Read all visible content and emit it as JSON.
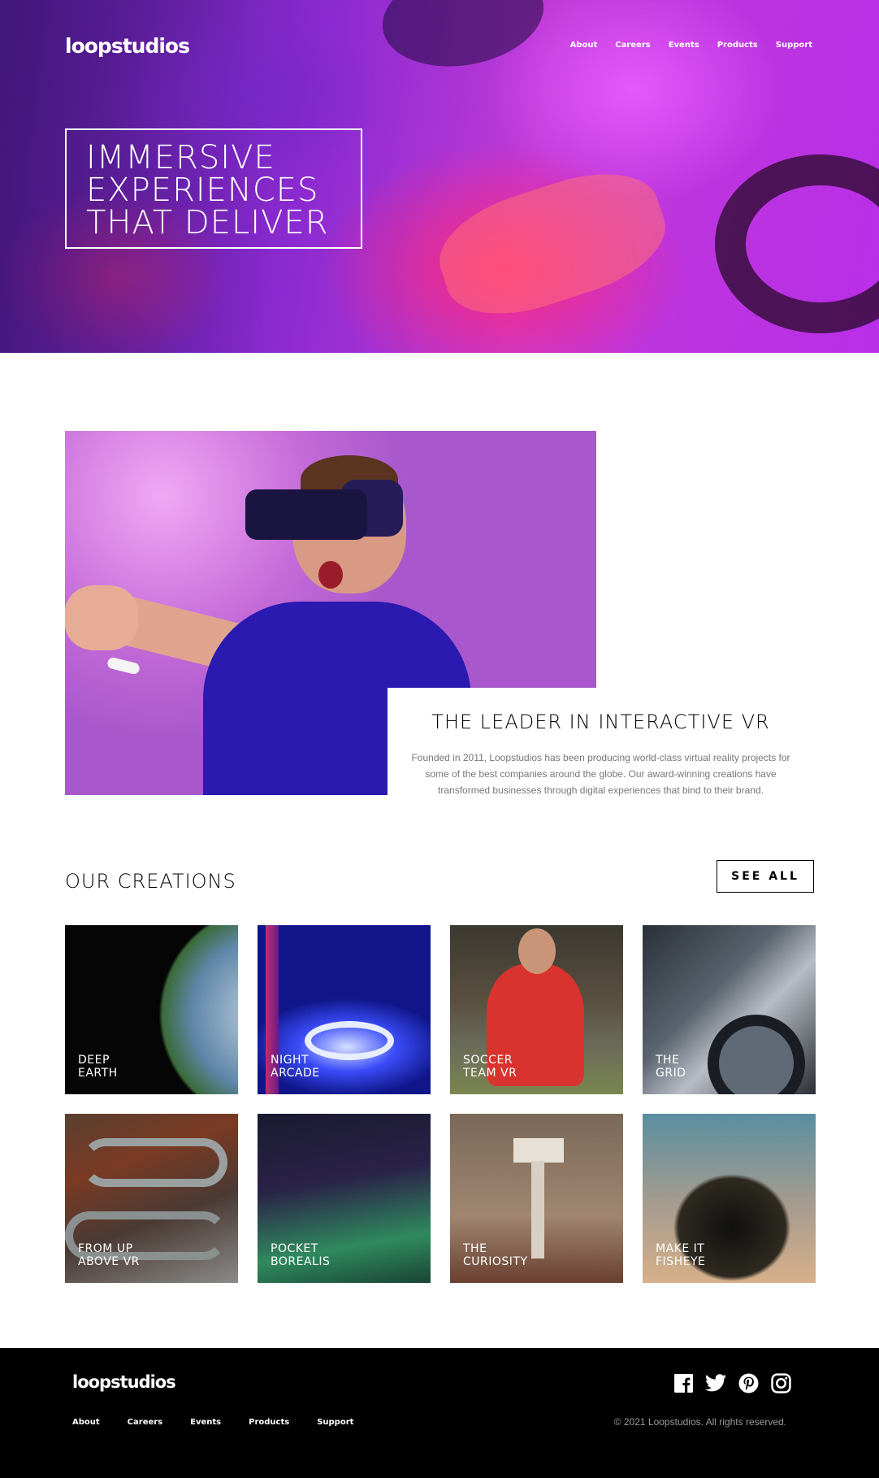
{
  "brand": {
    "logo": "loopstudios"
  },
  "nav": {
    "items": [
      "About",
      "Careers",
      "Events",
      "Products",
      "Support"
    ]
  },
  "hero": {
    "lines": [
      "IMMERSIVE",
      "EXPERIENCES",
      "THAT DELIVER"
    ]
  },
  "interactive": {
    "title": "THE LEADER IN INTERACTIVE VR",
    "body": "Founded in 2011, Loopstudios has been producing world-class virtual reality projects for some of the best companies around the globe. Our award-winning creations have transformed businesses through digital experiences that bind to their brand."
  },
  "creations": {
    "title": "OUR CREATIONS",
    "see_all": "SEE ALL",
    "items": [
      {
        "line1": "DEEP",
        "line2": "EARTH"
      },
      {
        "line1": "NIGHT",
        "line2": "ARCADE"
      },
      {
        "line1": "SOCCER",
        "line2": "TEAM VR"
      },
      {
        "line1": "THE",
        "line2": "GRID"
      },
      {
        "line1": "FROM UP",
        "line2": "ABOVE VR"
      },
      {
        "line1": "POCKET",
        "line2": "BOREALIS"
      },
      {
        "line1": "THE",
        "line2": "CURIOSITY"
      },
      {
        "line1": "MAKE IT",
        "line2": "FISHEYE"
      }
    ]
  },
  "footer": {
    "logo": "loopstudios",
    "nav": [
      "About",
      "Careers",
      "Events",
      "Products",
      "Support"
    ],
    "socials": [
      "facebook-icon",
      "twitter-icon",
      "pinterest-icon",
      "instagram-icon"
    ],
    "copyright": "© 2021 Loopstudios. All rights reserved."
  }
}
